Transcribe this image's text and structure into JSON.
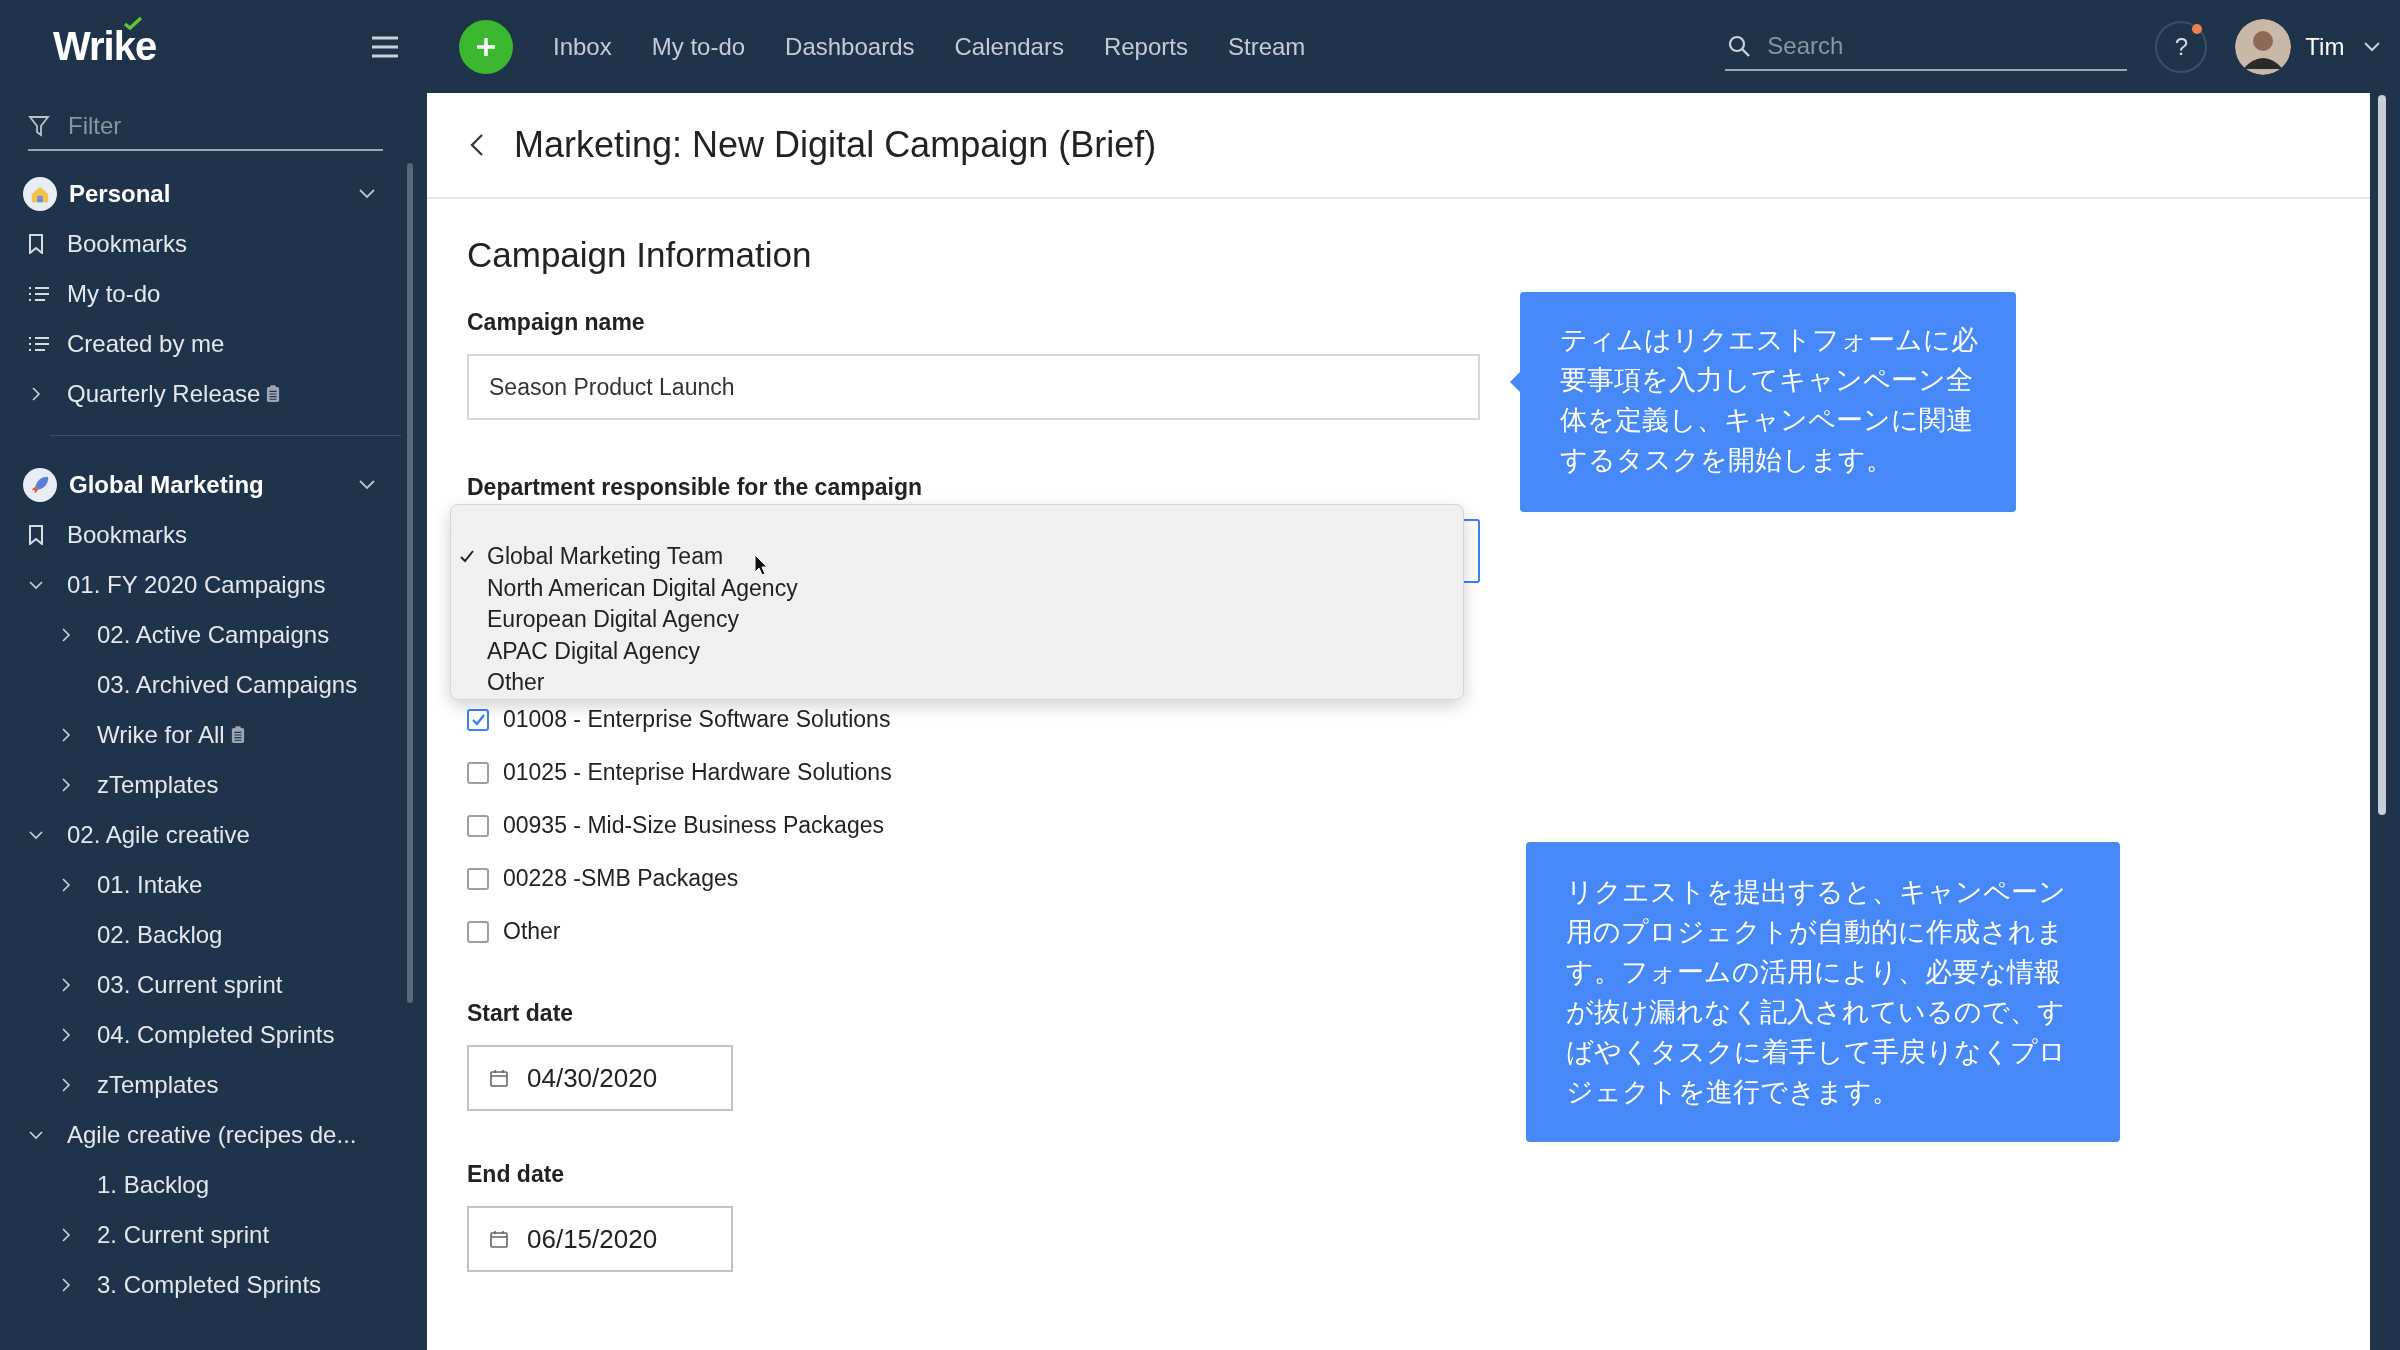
{
  "top_bar": {
    "logo": "Wrike",
    "nav": [
      {
        "label": "Inbox"
      },
      {
        "label": "My to-do"
      },
      {
        "label": "Dashboards"
      },
      {
        "label": "Calendars"
      },
      {
        "label": "Reports"
      },
      {
        "label": "Stream"
      }
    ],
    "search": {
      "placeholder": "Search"
    },
    "help": {
      "label": "?",
      "notification": true
    },
    "user": {
      "name": "Tim"
    }
  },
  "sidebar": {
    "filter": {
      "placeholder": "Filter"
    },
    "spaces": [
      {
        "name": "Personal",
        "kind": "personal",
        "expanded": true,
        "items": [
          {
            "kind": "bookmarks",
            "label": "Bookmarks"
          },
          {
            "kind": "list",
            "label": "My to-do"
          },
          {
            "kind": "list",
            "label": "Created by me"
          },
          {
            "kind": "folder",
            "label": "Quarterly Release",
            "expanded": false,
            "note": true
          }
        ]
      },
      {
        "name": "Global Marketing",
        "kind": "team",
        "expanded": true,
        "items": [
          {
            "kind": "bookmarks",
            "label": "Bookmarks"
          },
          {
            "kind": "folder",
            "label": "01. FY 2020 Campaigns",
            "expanded": true,
            "note": false,
            "children": [
              {
                "kind": "folder",
                "label": "02. Active Campaigns",
                "expanded": false,
                "note": false
              },
              {
                "kind": "leaf",
                "label": "03. Archived Campaigns",
                "note": false
              },
              {
                "kind": "folder",
                "label": "Wrike for All",
                "expanded": false,
                "note": true
              },
              {
                "kind": "folder",
                "label": "zTemplates",
                "expanded": false,
                "note": false
              }
            ]
          },
          {
            "kind": "folder",
            "label": "02. Agile creative",
            "expanded": true,
            "note": false,
            "children": [
              {
                "kind": "folder",
                "label": "01. Intake",
                "expanded": false,
                "note": false
              },
              {
                "kind": "leaf",
                "label": "02. Backlog",
                "note": false
              },
              {
                "kind": "folder",
                "label": "03. Current sprint",
                "expanded": false,
                "note": false
              },
              {
                "kind": "folder",
                "label": "04. Completed Sprints",
                "expanded": false,
                "note": false
              },
              {
                "kind": "folder",
                "label": "zTemplates",
                "expanded": false,
                "note": false
              }
            ]
          },
          {
            "kind": "folder",
            "label": "Agile creative (recipes de...",
            "expanded": true,
            "note": false,
            "children": [
              {
                "kind": "leaf",
                "label": "1. Backlog",
                "note": false
              },
              {
                "kind": "folder",
                "label": "2. Current sprint",
                "expanded": false,
                "note": false
              },
              {
                "kind": "folder",
                "label": "3. Completed Sprints",
                "expanded": false,
                "note": false
              }
            ]
          }
        ]
      }
    ]
  },
  "page": {
    "title": "Marketing: New Digital Campaign (Brief)",
    "section": "Campaign Information",
    "fields": [
      {
        "kind": "text",
        "label": "Campaign name",
        "value": "Season Product Launch"
      },
      {
        "kind": "select",
        "label": "Department responsible for the campaign",
        "open": true,
        "options": [
          {
            "label": "Global Marketing Team",
            "selected": true
          },
          {
            "label": "North American Digital Agency",
            "selected": false
          },
          {
            "label": "European Digital Agency",
            "selected": false
          },
          {
            "label": "APAC Digital Agency",
            "selected": false
          },
          {
            "label": "Other",
            "selected": false
          }
        ]
      },
      {
        "kind": "checkboxes",
        "options": [
          {
            "label": "01008 - Enterprise Software Solutions",
            "checked": true
          },
          {
            "label": "01025 - Enteprise Hardware Solutions",
            "checked": false
          },
          {
            "label": "00935 - Mid-Size Business Packages",
            "checked": false
          },
          {
            "label": "00228 -SMB Packages",
            "checked": false
          },
          {
            "label": "Other",
            "checked": false
          }
        ]
      },
      {
        "kind": "date",
        "label": "Start date",
        "value": "04/30/2020"
      },
      {
        "kind": "date",
        "label": "End date",
        "value": "06/15/2020"
      }
    ]
  },
  "callouts": [
    {
      "text": "ティムはリクエストフォームに必要事項を入力してキャンペーン全体を定義し、キャンペーンに関連するタスクを開始します。"
    },
    {
      "text": "リクエストを提出すると、キャンペーン用のプロジェクトが自動的に作成されます。フォームの活用により、必要な情報が抜け漏れなく記入されているので、すばやくタスクに着手して手戻りなくプロジェクトを進行できます。"
    }
  ]
}
